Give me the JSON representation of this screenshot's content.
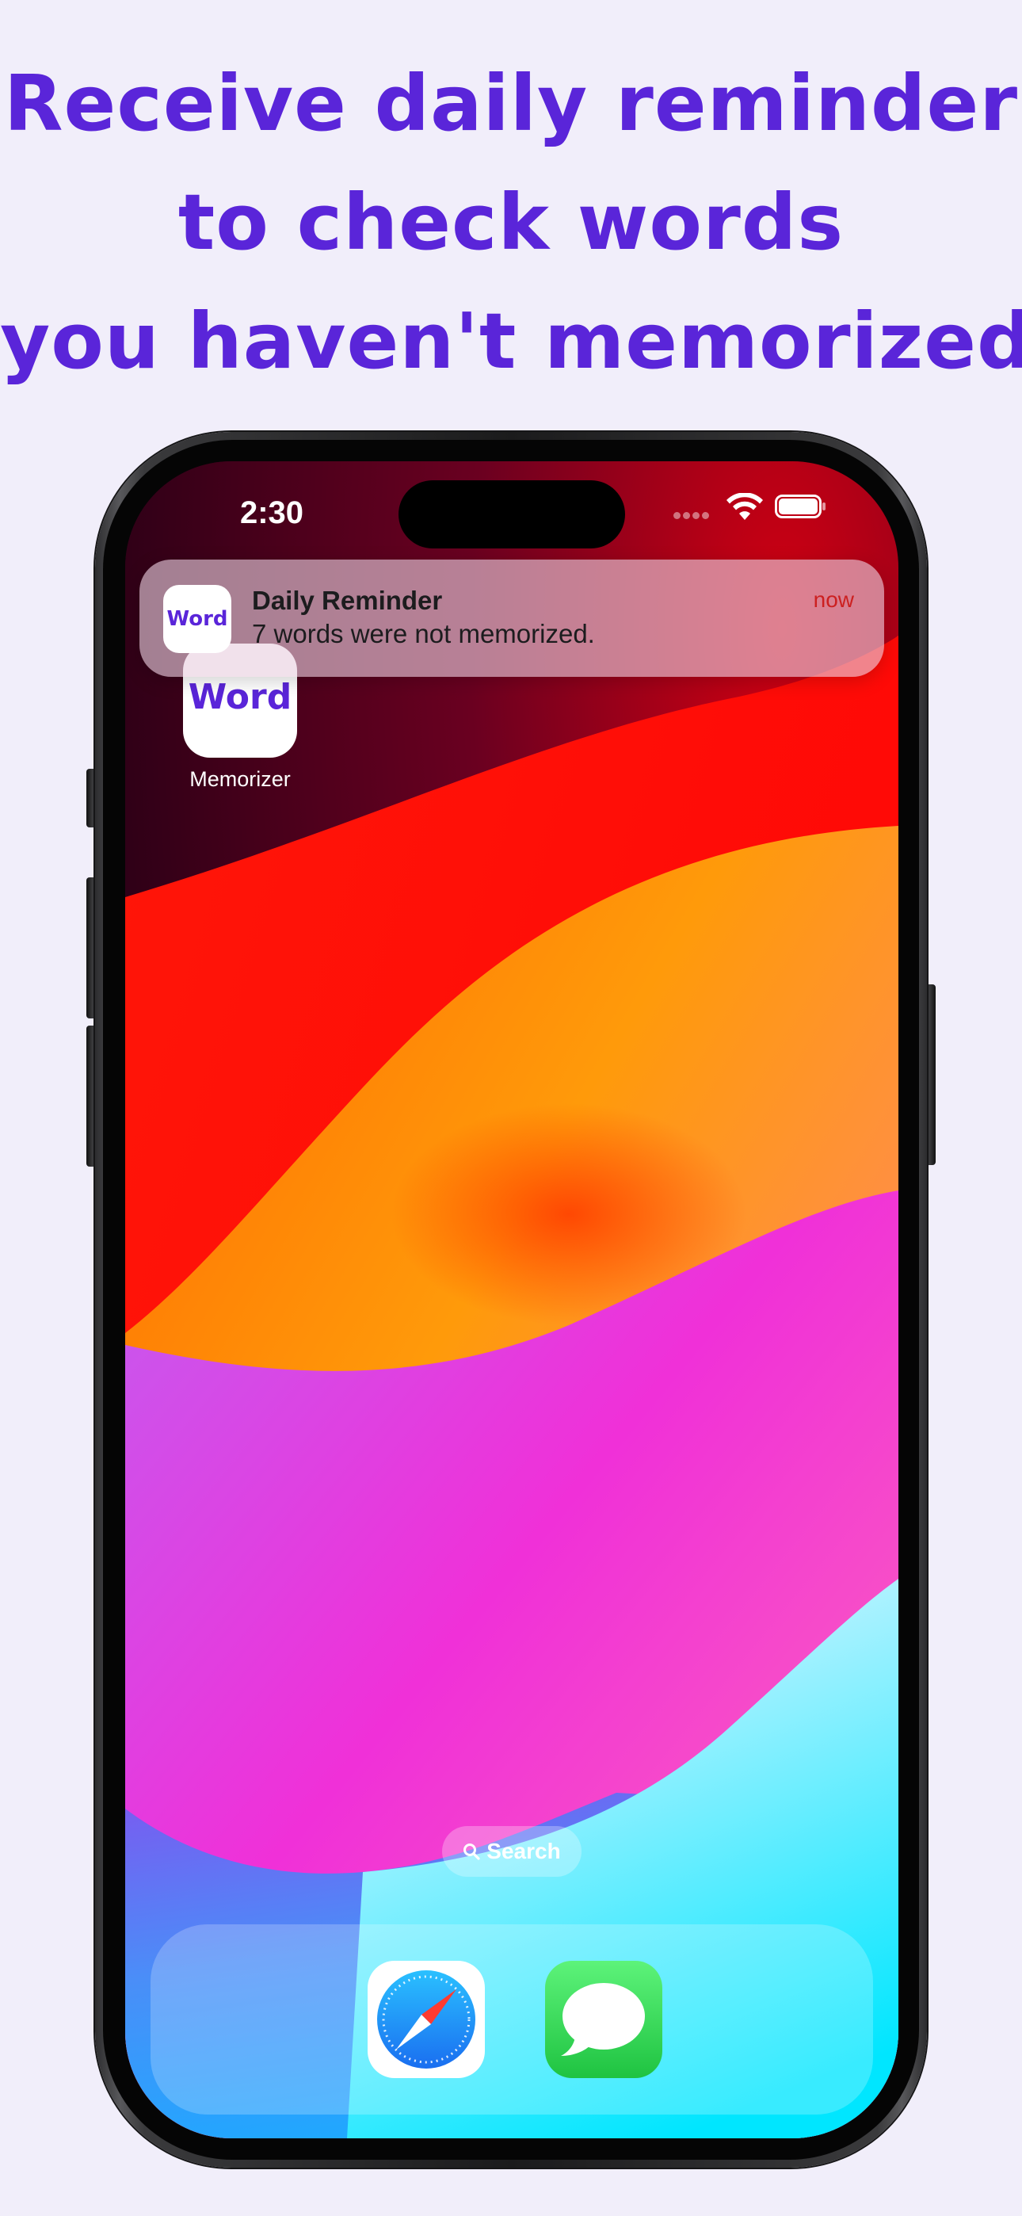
{
  "headline": {
    "line1": "Receive daily reminder",
    "line2": "to check words",
    "line3": "you haven't memorized"
  },
  "status_bar": {
    "time": "2:30",
    "icons": [
      "signal-dots-icon",
      "wifi-icon",
      "battery-icon"
    ]
  },
  "notification": {
    "app_icon_text": "Word",
    "title": "Daily Reminder",
    "body": "7 words were not memorized.",
    "time": "now"
  },
  "home_app": {
    "icon_text": "Word",
    "label": "Memorizer"
  },
  "search": {
    "label": "Search"
  },
  "dock": {
    "apps": [
      "safari-icon",
      "messages-icon"
    ]
  },
  "colors": {
    "background": "#f1eefa",
    "accent": "#5a25d9",
    "notification_time": "#cc2020"
  }
}
